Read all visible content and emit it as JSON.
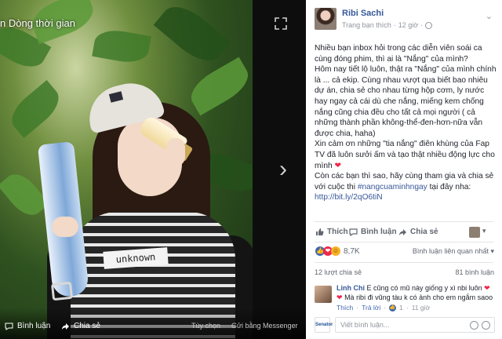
{
  "viewer": {
    "title": "n Dòng thời gian",
    "shirt_text": "unknown",
    "bar": {
      "comment": "Bình luận",
      "share": "Chia sẻ",
      "options": "Tùy chọn",
      "messenger": "Gửi bằng Messenger"
    }
  },
  "post": {
    "author": "Ribi Sachi",
    "meta_page": "Trang bạn thích",
    "meta_time": "12 giờ",
    "p1": "Nhiều bạn inbox hỏi trong các diễn viên soái ca cùng đóng phim, thì ai là \"Nắng\" của mình?",
    "p2": "Hôm nay tiết lộ luôn, thật ra \"Nắng\" của mình chính là ... cả ekip. Cùng nhau vượt qua biết bao nhiêu dự án, chia sẻ cho nhau từng hộp cơm, ly nước hay ngay cả cái dù che nắng, miếng kem chống nắng cũng chia đều cho tất cả mọi người ( cả những thành phần không-thể-đen-hơn-nữa vẫn được chia, haha)",
    "p3": "Xin cảm ơn những \"tia nắng\" điên khùng của Fap TV đã luôn sưởi ấm và tạo thật nhiều động lực cho mình",
    "p4_pre": "Còn các bạn thì sao, hãy cùng tham gia và chia sẻ với cuộc thi ",
    "p4_tag": "#nangcuaminhngay",
    "p4_post": " tại đây nha:",
    "link": "http://bit.ly/2qO6tiN"
  },
  "actions": {
    "like": "Thích",
    "comment": "Bình luận",
    "share": "Chia sẻ"
  },
  "reactions": {
    "count": "8,7K",
    "related": "Bình luận liên quan nhất"
  },
  "counts": {
    "shares": "12 lượt chia sẻ",
    "comments": "81 bình luận"
  },
  "comment": {
    "name": "Linh Chi",
    "text1": "E cũng có mũ này giống y xì nbi luôn",
    "text2": "Mà ribi đi vũng tàu k có ảnh cho em ngắm saoo",
    "reply_like": "Thích",
    "reply": "Trả lời",
    "likes": "1",
    "time": "11 giờ"
  },
  "composer": {
    "avatar_text": "Senator",
    "placeholder": "Viết bình luận..."
  },
  "colors": {
    "link": "#365899",
    "facebook_blue": "#4267b2",
    "heart": "#f0284a"
  }
}
